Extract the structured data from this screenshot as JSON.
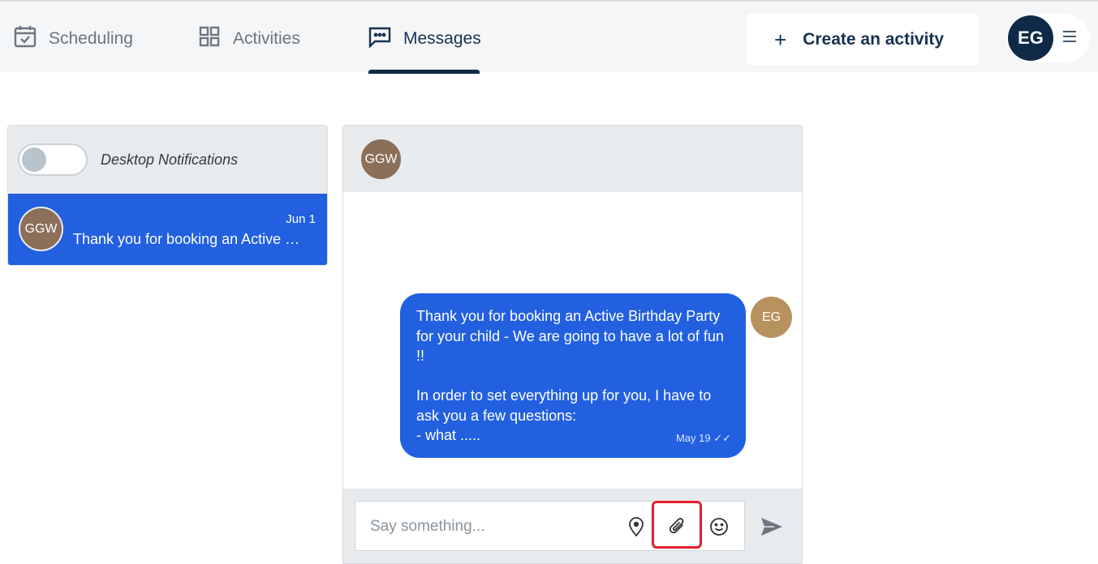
{
  "nav": {
    "tabs": [
      {
        "label": "Scheduling",
        "icon": "calendar-check-icon"
      },
      {
        "label": "Activities",
        "icon": "grid-icon"
      },
      {
        "label": "Messages",
        "icon": "chat-icon",
        "active": true
      }
    ],
    "create_label": "Create an activity",
    "user_initials": "EG"
  },
  "sidebar": {
    "notifications_label": "Desktop Notifications",
    "conversation": {
      "initials": "GGW",
      "date": "Jun 1",
      "preview": "Thank you for booking an Active Birthday Party for your child - We are going to have a lot of fun !!"
    }
  },
  "chat": {
    "header_initials": "GGW",
    "message": {
      "text": "Thank you for booking an Active Birthday Party for your child - We are going to have a lot of fun !!\n\nIn order to set everything up for you, I have to ask you a few questions:\n- what .....",
      "meta": "May 19 ✓✓",
      "sender_initials": "EG"
    },
    "composer": {
      "placeholder": "Say something..."
    }
  },
  "colors": {
    "accent": "#2260e0",
    "navy": "#0e2a47",
    "highlight": "#e0202e"
  }
}
